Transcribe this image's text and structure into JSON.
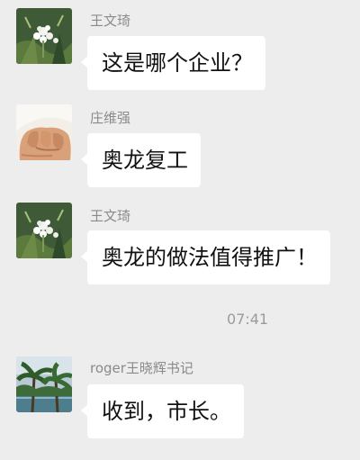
{
  "messages": [
    {
      "sender": "王文琦",
      "text": "这是哪个企业？",
      "avatar_icon": "white-flower-avatar-icon"
    },
    {
      "sender": "庄维强",
      "text": "奥龙复工",
      "avatar_icon": "fist-avatar-icon"
    },
    {
      "sender": "王文琦",
      "text": "奥龙的做法值得推广！",
      "avatar_icon": "white-flower-avatar-icon"
    },
    {
      "sender": "roger王晓辉书记",
      "text": "收到，市长。",
      "avatar_icon": "palm-trees-avatar-icon"
    }
  ],
  "timestamp": "07:41",
  "colors": {
    "background": "#ededed",
    "bubble": "#ffffff",
    "sender_text": "#8a8a8a",
    "message_text": "#111111",
    "timestamp_text": "#9a9a9a"
  }
}
